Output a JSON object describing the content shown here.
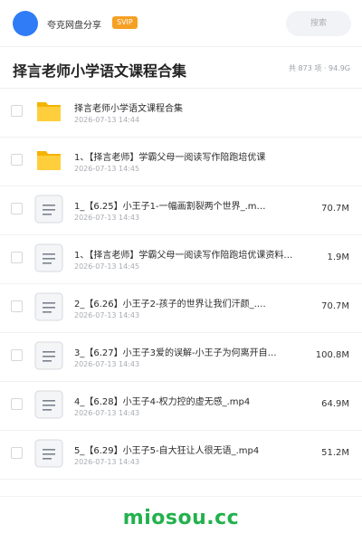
{
  "header": {
    "app_name": "夸克网盘分享",
    "badge": "SVIP",
    "search_placeholder": "搜索",
    "accent": "#2f7cf6",
    "badge_color": "#f6a023"
  },
  "folder": {
    "title": "择言老师小学语文课程合集",
    "summary": "共 873 项 · 94.9G"
  },
  "files": [
    {
      "name": "择言老师小学语文课程合集",
      "date": "2026-07-13 14:44",
      "size": "",
      "icon": "folder-icon"
    },
    {
      "name": "1、【择言老师】学霸父母一阅读写作陪跑培优课",
      "date": "2026-07-13 14:45",
      "size": "",
      "icon": "folder-icon"
    },
    {
      "name": "1_【6.25】小王子1-一幅画割裂两个世界_.m…",
      "date": "2026-07-13 14:43",
      "size": "70.7M",
      "icon": "file-icon"
    },
    {
      "name": "1、【择言老师】学霸父母一阅读写作陪跑培优课资料…",
      "date": "2026-07-13 14:45",
      "size": "1.9M",
      "icon": "file-icon"
    },
    {
      "name": "2_【6.26】小王子2-孩子的世界让我们汗颜_.…",
      "date": "2026-07-13 14:43",
      "size": "70.7M",
      "icon": "file-icon"
    },
    {
      "name": "3_【6.27】小王子3爱的误解-小王子为何离开自…",
      "date": "2026-07-13 14:43",
      "size": "100.8M",
      "icon": "file-icon"
    },
    {
      "name": "4_【6.28】小王子4-权力控的虚无感_.mp4",
      "date": "2026-07-13 14:43",
      "size": "64.9M",
      "icon": "file-icon"
    },
    {
      "name": "5_【6.29】小王子5-自大狂让人很无语_.mp4",
      "date": "2026-07-13 14:43",
      "size": "51.2M",
      "icon": "file-icon"
    }
  ],
  "footer": {
    "brand": "miosou.cc",
    "brand_color": "#22b14c"
  }
}
